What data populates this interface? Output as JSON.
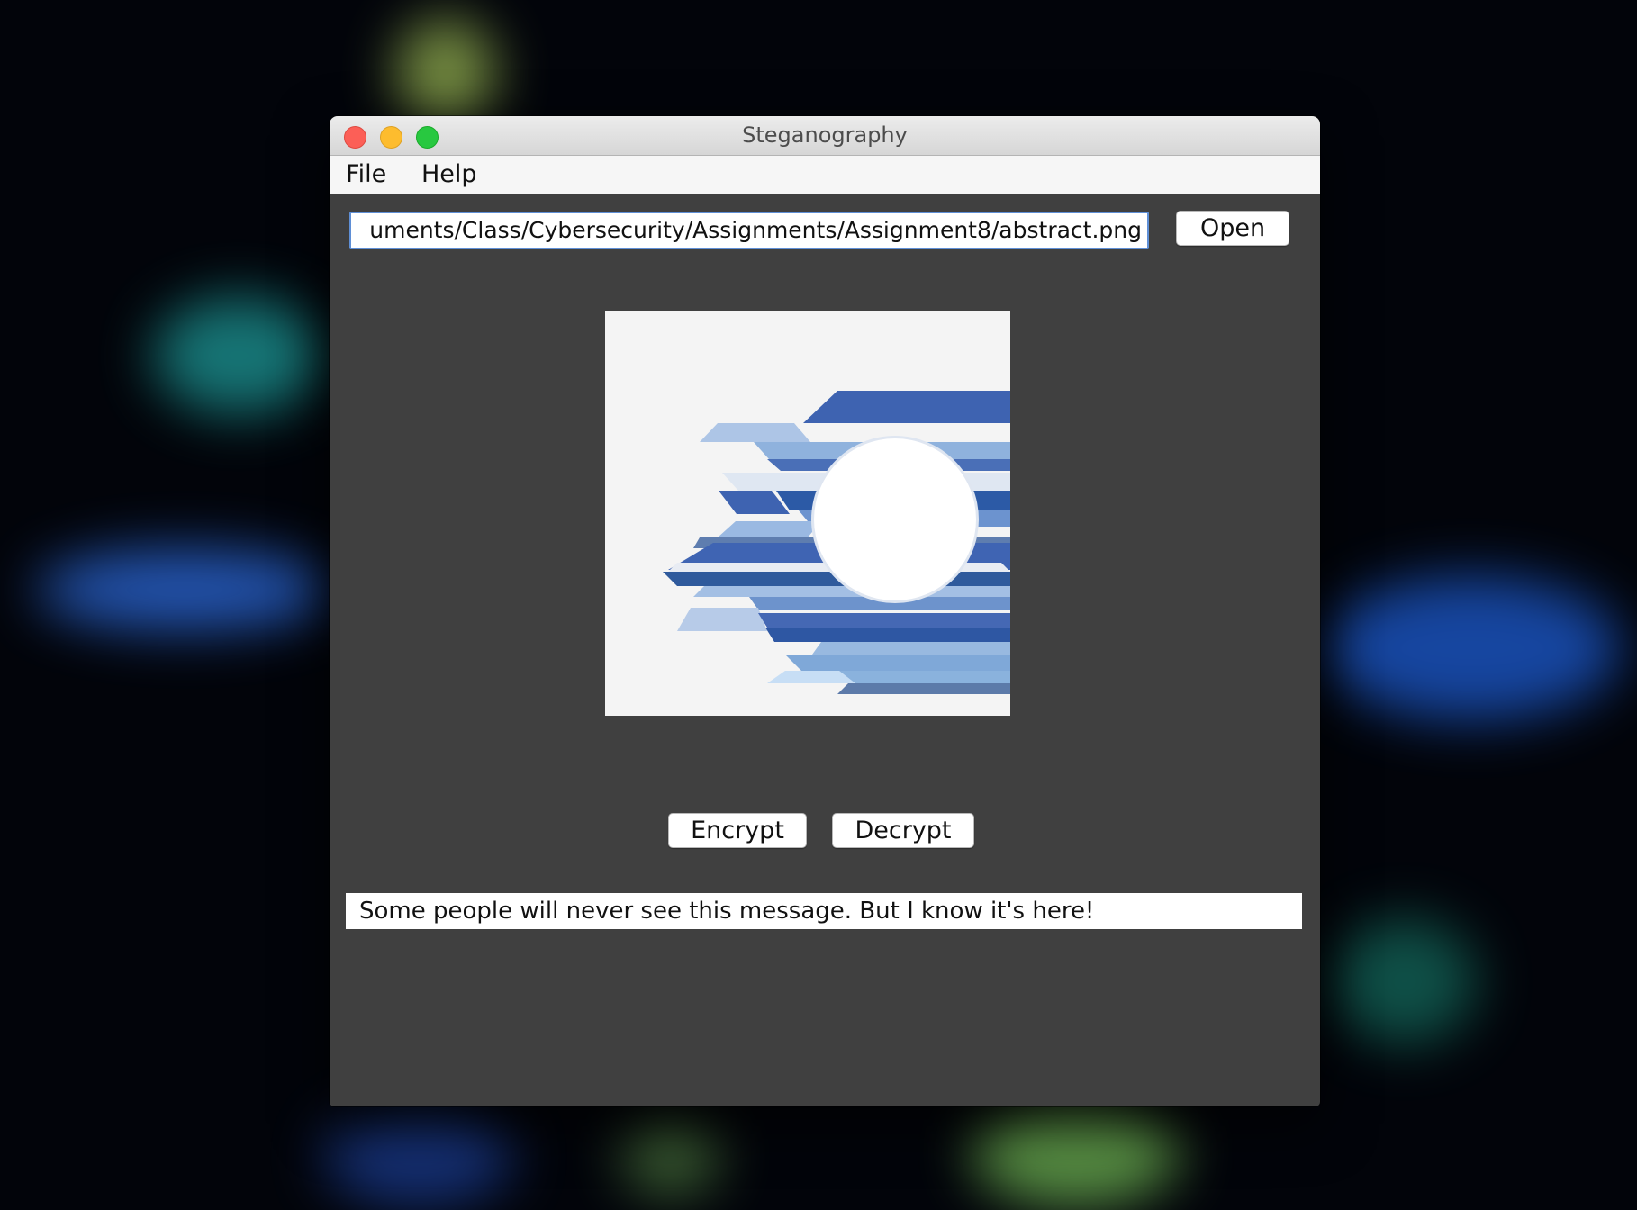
{
  "window": {
    "title": "Steganography"
  },
  "menubar": {
    "items": [
      {
        "label": "File"
      },
      {
        "label": "Help"
      }
    ]
  },
  "file_path": {
    "value": "uments/Class/Cybersecurity/Assignments/Assignment8/abstract.png"
  },
  "buttons": {
    "open": "Open",
    "encrypt": "Encrypt",
    "decrypt": "Decrypt"
  },
  "message": {
    "value": "Some people will never see this message. But I know it's here!"
  },
  "colors": {
    "window_background": "#404040",
    "title_bar": "#e4e4e4",
    "focus_ring": "#5f8fd6",
    "traffic_close": "#fc5f57",
    "traffic_minimize": "#fdbc2e",
    "traffic_zoom": "#28c840",
    "image_accent": "#3f63b0"
  }
}
